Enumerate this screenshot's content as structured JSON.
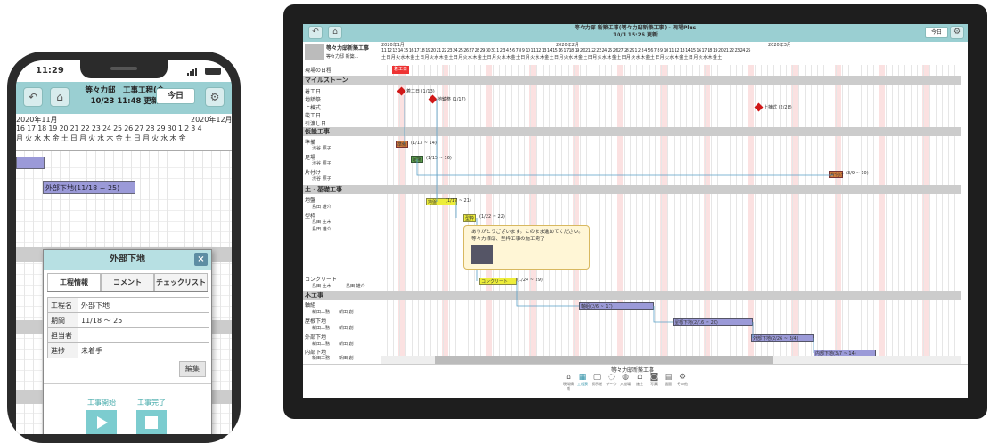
{
  "phone": {
    "time": "11:29",
    "title_line1": "等々力邸　工事工程(含",
    "title_line2": "10/23 11:48 更新",
    "today_label": "今日",
    "months": [
      "2020年11月",
      "2020年12月"
    ],
    "dates": "16 17 18 19 20 21 22 23 24 25 26 27 28 29 30  1  2  3  4",
    "weekdays": "月 火 水 木 金 土 日 月 火 水 木 金 土 日 月 火 水 木 金",
    "bar_label": "外部下地",
    "bar_range": "(11/18 ~ 25)",
    "dialog": {
      "title": "外部下地",
      "close": "×",
      "tabs": [
        "工程情報",
        "コメント",
        "チェックリスト"
      ],
      "rows": [
        {
          "k": "工程名",
          "v": "外部下地"
        },
        {
          "k": "期間",
          "v": "11/18 ～ 25"
        },
        {
          "k": "担当者",
          "v": ""
        },
        {
          "k": "進捗",
          "v": "未着手"
        }
      ],
      "edit": "編集",
      "start": "工事開始",
      "complete": "工事完了"
    }
  },
  "tablet": {
    "title_line1": "等々力邸 新築工事(等々力邸新築工事) - 現場Plus",
    "title_line2": "10/1 15:26 更新",
    "today_label": "今日",
    "site_name": "等々力邸新築工事",
    "site_sub": "等々力邸 新築...",
    "months": [
      "2020年1月",
      "2020年2月",
      "2020年3月"
    ],
    "dates": "11 12 13 14 15 16 17 18 19 20 21 22 23 24 25 26 27 28 29 30 31  1  2  3  4  5  6  7  8  9 10 11 12 13 14 15 16 17 18 19 20 21 22 23 24 25 26 27 28 29  1  2  3  4  5  6  7  8  9 10 11 12 13 14 15 16 17 18 19 20 21 22 23 24 25",
    "weekdays": "土 日 月 火 水 木 金 土 日 月 火 水 木 金 土 日 月 火 水 木 金 土 日 月 火 水 木 金 土 日 月 火 水 木 金 土 日 月 火 水 木 金 土 日 月 火 水 木 金 土 日 月 火 水 木 金 土 日 月 火 水 木 金 土 日 月 火 水 木 金 土",
    "sections": [
      "マイルストーン",
      "仮設工事",
      "土・基礎工事",
      "木工事"
    ],
    "rows": [
      "現場の日程",
      "着工日",
      "地鎮祭",
      "上棟式",
      "竣工日",
      "引渡し日",
      "準備",
      "足場",
      "片付け",
      "地盤",
      "型枠",
      "コンクリート",
      "軸組",
      "屋根下地",
      "外部下地",
      "内部下地"
    ],
    "people": [
      "渋谷 照子",
      "渋谷 照子",
      "渋谷 照子",
      "島田 雄介",
      "島田 土木",
      "島田 雄介",
      "島田 土木",
      "島田 雄介",
      "新田工務",
      "新田 創",
      "新田工務",
      "新田 創",
      "新田工務",
      "新田 創",
      "新田工務",
      "新田 創"
    ],
    "milestones": [
      "着工日 (1/13)",
      "地鎮祭 (1/17)",
      "上棟式 (2/28)"
    ],
    "bars": [
      {
        "label": "準備",
        "range": "(1/13 ~ 14)"
      },
      {
        "label": "足場",
        "range": "(1/15 ~ 16)"
      },
      {
        "label": "片付け",
        "range": "(3/9 ~ 10)"
      },
      {
        "label": "地盤",
        "range": "(1/17 ~ 21)"
      },
      {
        "label": "型枠",
        "range": "(1/22 ~ 22)"
      },
      {
        "label": "コンクリート",
        "range": "(1/24 ~ 29)"
      },
      {
        "label": "軸組",
        "range": "(2/6 ~ 17)"
      },
      {
        "label": "屋根下地",
        "range": "(2/16 ~ 20)"
      },
      {
        "label": "外部下地",
        "range": "(2/26 ~ 3/4)"
      },
      {
        "label": "内部下地",
        "range": "(3/7 ~ 14)"
      }
    ],
    "site_label": "着工日",
    "comment_line1": "ありがとうございます。このまま進めてください。",
    "comment_line2": "等々力様邸、型枠工事の施工完了",
    "footer_project": "等々力邸新築工事",
    "nav": [
      "現場情報",
      "工程表",
      "掲示板",
      "チーク",
      "入退場",
      "施主",
      "写真",
      "図面",
      "その他"
    ]
  }
}
